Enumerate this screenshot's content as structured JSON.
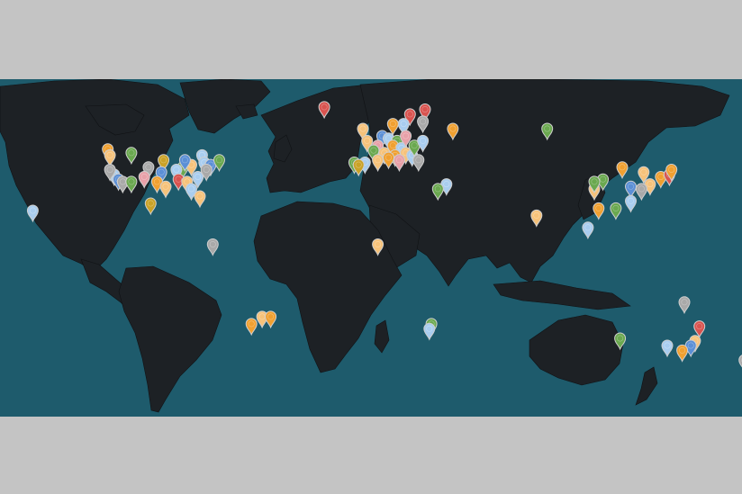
{
  "map": {
    "colors": {
      "ocean": "#1e5b6c",
      "land": "#1d2125",
      "page_background": "#c4c4c4"
    },
    "marker_palette": {
      "orange": "#f0a030",
      "peach": "#f6c27a",
      "light_blue": "#a9cdef",
      "blue": "#5b8fd6",
      "green": "#6aa84f",
      "red": "#d9534f",
      "gray": "#a9a9a9",
      "pink": "#e8a0a8",
      "mustard": "#c9a227"
    },
    "regions": [
      {
        "name": "north-america",
        "pins": [
          {
            "color": "orange",
            "lon": -123,
            "lat": 46.5
          },
          {
            "color": "peach",
            "lon": -122,
            "lat": 44
          },
          {
            "color": "green",
            "lon": -112,
            "lat": 45
          },
          {
            "color": "mustard",
            "lon": -97,
            "lat": 42
          },
          {
            "color": "light_blue",
            "lon": -79,
            "lat": 44
          },
          {
            "color": "light_blue",
            "lon": -78,
            "lat": 41
          },
          {
            "color": "blue",
            "lon": -75,
            "lat": 40
          },
          {
            "color": "green",
            "lon": -88,
            "lat": 39
          },
          {
            "color": "peach",
            "lon": -84,
            "lat": 40
          },
          {
            "color": "light_blue",
            "lon": -91,
            "lat": 38
          },
          {
            "color": "blue",
            "lon": -98,
            "lat": 37
          },
          {
            "color": "gray",
            "lon": -104,
            "lat": 39
          },
          {
            "color": "light_blue",
            "lon": -120,
            "lat": 36
          },
          {
            "color": "blue",
            "lon": -118,
            "lat": 34
          },
          {
            "color": "gray",
            "lon": -116,
            "lat": 33
          },
          {
            "color": "green",
            "lon": -112,
            "lat": 33
          },
          {
            "color": "pink",
            "lon": -106,
            "lat": 35
          },
          {
            "color": "orange",
            "lon": -100,
            "lat": 33
          },
          {
            "color": "peach",
            "lon": -96,
            "lat": 31
          },
          {
            "color": "red",
            "lon": -90,
            "lat": 34
          },
          {
            "color": "peach",
            "lon": -86,
            "lat": 33
          },
          {
            "color": "light_blue",
            "lon": -81,
            "lat": 35
          },
          {
            "color": "gray",
            "lon": -77,
            "lat": 38
          },
          {
            "color": "light_blue",
            "lon": -84,
            "lat": 30
          },
          {
            "color": "peach",
            "lon": -80,
            "lat": 27
          },
          {
            "color": "green",
            "lon": -71,
            "lat": 42
          },
          {
            "color": "mustard",
            "lon": -103,
            "lat": 24
          },
          {
            "color": "blue",
            "lon": -87,
            "lat": 42
          },
          {
            "color": "gray",
            "lon": -122,
            "lat": 38
          }
        ]
      },
      {
        "name": "south-america",
        "pins": [
          {
            "color": "gray",
            "lon": -74,
            "lat": 7
          },
          {
            "color": "orange",
            "lon": -56,
            "lat": -26
          },
          {
            "color": "peach",
            "lon": -51,
            "lat": -23
          },
          {
            "color": "orange",
            "lon": -47,
            "lat": -23
          }
        ]
      },
      {
        "name": "europe",
        "pins": [
          {
            "color": "red",
            "lon": -22,
            "lat": 64
          },
          {
            "color": "red",
            "lon": 18,
            "lat": 61
          },
          {
            "color": "red",
            "lon": 25,
            "lat": 63
          },
          {
            "color": "light_blue",
            "lon": 15,
            "lat": 57
          },
          {
            "color": "peach",
            "lon": -4,
            "lat": 55
          },
          {
            "color": "orange",
            "lon": 10,
            "lat": 57
          },
          {
            "color": "blue",
            "lon": 5,
            "lat": 52
          },
          {
            "color": "light_blue",
            "lon": 8,
            "lat": 51
          },
          {
            "color": "green",
            "lon": 12,
            "lat": 50
          },
          {
            "color": "peach",
            "lon": -2,
            "lat": 50
          },
          {
            "color": "pink",
            "lon": 3,
            "lat": 48
          },
          {
            "color": "orange",
            "lon": 10,
            "lat": 48
          },
          {
            "color": "light_blue",
            "lon": 14,
            "lat": 47
          },
          {
            "color": "peach",
            "lon": 6,
            "lat": 45
          },
          {
            "color": "green",
            "lon": 1,
            "lat": 46
          },
          {
            "color": "orange",
            "lon": 11,
            "lat": 44
          },
          {
            "color": "peach",
            "lon": 16,
            "lat": 45
          },
          {
            "color": "light_blue",
            "lon": -3,
            "lat": 41
          },
          {
            "color": "green",
            "lon": -8,
            "lat": 41
          },
          {
            "color": "mustard",
            "lon": -6,
            "lat": 40
          },
          {
            "color": "peach",
            "lon": 3,
            "lat": 42
          },
          {
            "color": "orange",
            "lon": 8,
            "lat": 43
          },
          {
            "color": "pink",
            "lon": 13,
            "lat": 42
          },
          {
            "color": "light_blue",
            "lon": 19,
            "lat": 44
          },
          {
            "color": "gray",
            "lon": 22,
            "lat": 42
          },
          {
            "color": "orange",
            "lon": 38,
            "lat": 55
          },
          {
            "color": "gray",
            "lon": 24,
            "lat": 58
          },
          {
            "color": "pink",
            "lon": 16,
            "lat": 52
          },
          {
            "color": "green",
            "lon": 20,
            "lat": 48
          },
          {
            "color": "light_blue",
            "lon": 24,
            "lat": 50
          }
        ]
      },
      {
        "name": "russia",
        "pins": [
          {
            "color": "green",
            "lon": 82,
            "lat": 55
          }
        ]
      },
      {
        "name": "middle-east-africa",
        "pins": [
          {
            "color": "light_blue",
            "lon": 35,
            "lat": 32
          },
          {
            "color": "green",
            "lon": 31,
            "lat": 30
          },
          {
            "color": "peach",
            "lon": 3,
            "lat": 7
          },
          {
            "color": "green",
            "lon": 28,
            "lat": -26
          },
          {
            "color": "light_blue",
            "lon": 27,
            "lat": -28
          }
        ]
      },
      {
        "name": "asia",
        "pins": [
          {
            "color": "peach",
            "lon": 77,
            "lat": 19
          },
          {
            "color": "green",
            "lon": 108,
            "lat": 34
          },
          {
            "color": "light_blue",
            "lon": 101,
            "lat": 14
          },
          {
            "color": "orange",
            "lon": 106,
            "lat": 22
          },
          {
            "color": "peach",
            "lon": 104,
            "lat": 30
          },
          {
            "color": "green",
            "lon": 104,
            "lat": 33
          },
          {
            "color": "orange",
            "lon": 117,
            "lat": 39
          },
          {
            "color": "blue",
            "lon": 121,
            "lat": 31
          },
          {
            "color": "light_blue",
            "lon": 121,
            "lat": 25
          },
          {
            "color": "green",
            "lon": 114,
            "lat": 22
          },
          {
            "color": "peach",
            "lon": 127,
            "lat": 37
          },
          {
            "color": "orange",
            "lon": 135,
            "lat": 35
          },
          {
            "color": "red",
            "lon": 139,
            "lat": 36
          },
          {
            "color": "peach",
            "lon": 130,
            "lat": 32
          },
          {
            "color": "orange",
            "lon": 140,
            "lat": 38
          },
          {
            "color": "gray",
            "lon": 126,
            "lat": 30
          }
        ]
      },
      {
        "name": "oceania",
        "pins": [
          {
            "color": "light_blue",
            "lon": -158,
            "lat": 21
          },
          {
            "color": "gray",
            "lon": 146,
            "lat": -17
          },
          {
            "color": "red",
            "lon": 153,
            "lat": -27
          },
          {
            "color": "peach",
            "lon": 151,
            "lat": -33
          },
          {
            "color": "blue",
            "lon": 149,
            "lat": -35
          },
          {
            "color": "orange",
            "lon": 145,
            "lat": -37
          },
          {
            "color": "light_blue",
            "lon": 138,
            "lat": -35
          },
          {
            "color": "green",
            "lon": 116,
            "lat": -32
          },
          {
            "color": "gray",
            "lon": 174,
            "lat": -41
          }
        ]
      }
    ]
  }
}
